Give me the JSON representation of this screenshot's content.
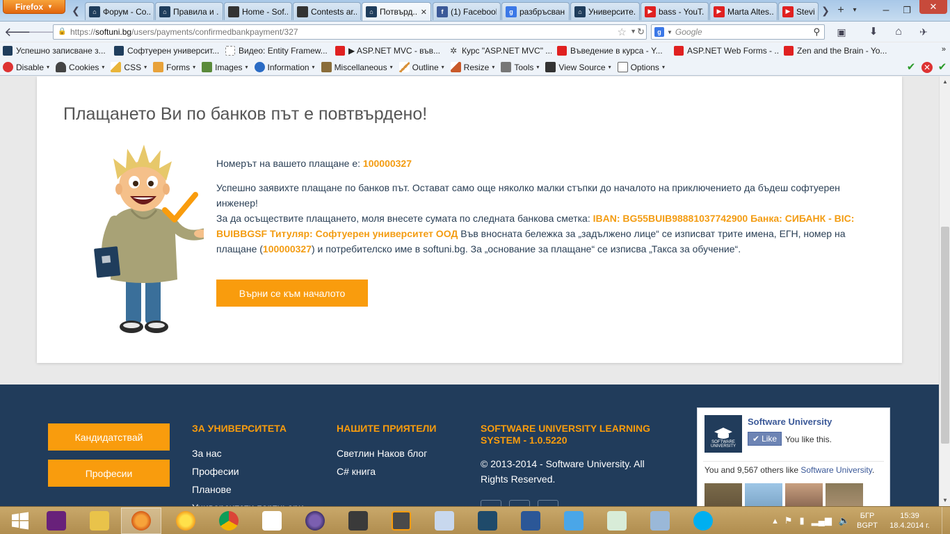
{
  "browser": {
    "app_button": "Firefox",
    "tabs": [
      {
        "title": "Форум - Со...",
        "fav": "su"
      },
      {
        "title": "Правила и ...",
        "fav": "su"
      },
      {
        "title": "Home - Sof...",
        "fav": "home"
      },
      {
        "title": "Contests ar...",
        "fav": "home"
      },
      {
        "title": "Потвърд...",
        "fav": "su",
        "active": true
      },
      {
        "title": "(1) Facebook",
        "fav": "fb"
      },
      {
        "title": "разбръсван...",
        "fav": "g"
      },
      {
        "title": "Университе...",
        "fav": "su"
      },
      {
        "title": "bass - YouT...",
        "fav": "yt"
      },
      {
        "title": "Marta Altes...",
        "fav": "yt"
      },
      {
        "title": "Stevie",
        "fav": "yt"
      }
    ],
    "url_prefix": "https://",
    "url_domain": "softuni.bg",
    "url_path": "/users/payments/confirmedbankpayment/327",
    "search_placeholder": "Google",
    "bookmarks": [
      "Успешно записване з...",
      "Софтуерен университ...",
      "Видео: Entity Framew...",
      "▶ ASP.NET MVC - във...",
      "Курс \"ASP.NET MVC\" ...",
      "Въведение в курса - Y...",
      "ASP.NET Web Forms - ...",
      "Zen and the Brain - Yo..."
    ],
    "devtools": [
      "Disable",
      "Cookies",
      "CSS",
      "Forms",
      "Images",
      "Information",
      "Miscellaneous",
      "Outline",
      "Resize",
      "Tools",
      "View Source",
      "Options"
    ]
  },
  "page": {
    "title": "Плащането Ви по банков път е повтвърдено!",
    "payment_number_label": "Номерът на вашето плащане е: ",
    "payment_number": "100000327",
    "success_text": "Успешно заявихте плащане по банков път. Остават само още няколко малки стъпки до началото на приключението да бъдеш софтуерен инженер!",
    "instructions_prefix": "За да осъществите плащането, моля внесете сумата по следната банкова сметка: ",
    "bank_details": "IBAN: BG55BUIB98881037742900 Банка: СИБАНК - BIC: BUIBBGSF Титуляр: Софтуерен университет ООД",
    "instructions_middle": " Във вносната бележка за „задължено лице“ се изписват трите имена, ЕГН, номер на плащане (",
    "instructions_number": "100000327",
    "instructions_suffix": ") и потребителско име в softuni.bg. За „основание за плащане“ се изписва „Такса за обучение“.",
    "back_button": "Върни се към началото"
  },
  "footer": {
    "buttons": [
      "Кандидатствай",
      "Професии"
    ],
    "university": {
      "heading": "ЗА УНИВЕРСИТЕТА",
      "links": [
        "За нас",
        "Професии",
        "Планове",
        "Университети партньори"
      ]
    },
    "friends": {
      "heading": "НАШИТЕ ПРИЯТЕЛИ",
      "links": [
        "Светлин Наков блог",
        "C# книга"
      ]
    },
    "system": {
      "heading": "SOFTWARE UNIVERSITY LEARNING SYSTEM - 1.0.5220",
      "copyright": "© 2013-2014 - Software University. All Rights Reserved."
    },
    "facebook": {
      "page_name": "Software University",
      "logo_text": "SOFTWARE UNIVERSITY",
      "like_label": "Like",
      "you_like": "You like this.",
      "others_prefix": "You and 9,567 others like ",
      "others_link": "Software University",
      "others_suffix": "."
    }
  },
  "taskbar": {
    "language_top": "БГР",
    "language_bottom": "BGPT",
    "time": "15:39",
    "date": "18.4.2014 г."
  },
  "colors": {
    "accent_orange": "#f99c0d",
    "footer_bg": "#213c5b",
    "text_blue": "#2a3f55"
  }
}
